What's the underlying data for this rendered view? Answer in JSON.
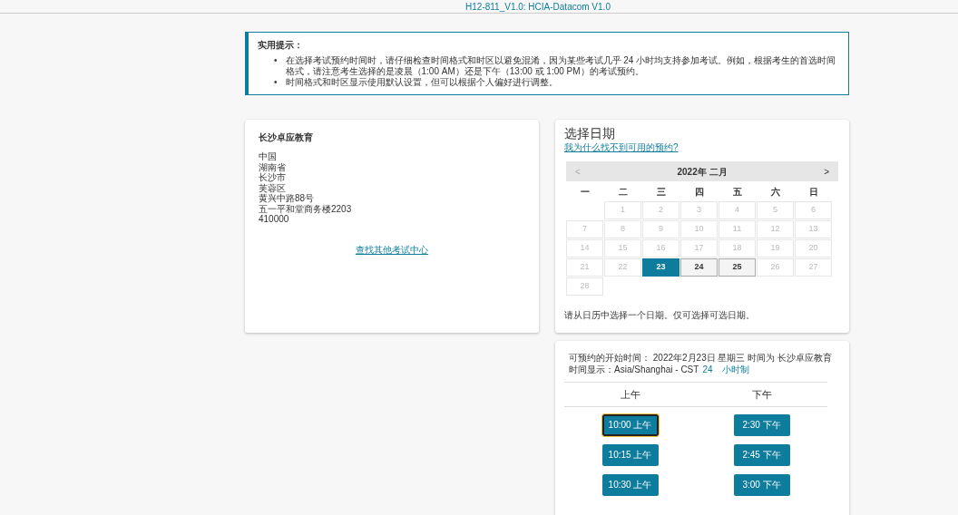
{
  "header": {
    "title": "H12-811_V1.0: HCIA-Datacom V1.0"
  },
  "notice": {
    "heading": "实用提示：",
    "marker": "•",
    "items": [
      "在选择考试预约时间时，请仔细检查时间格式和时区以避免混淆，因为某些考试几乎 24 小时均支持参加考试。例如，根据考生的首选时间格式，请注意考生选择的是凌晨（1:00 AM）还是下午（13:00 或 1:00 PM）的考试预约。",
      "时间格式和时区显示使用默认设置，但可以根据个人偏好进行调整。"
    ]
  },
  "test_center": {
    "name": "长沙卓应教育",
    "address_lines": [
      "中国",
      "湖南省",
      "长沙市",
      "芙蓉区",
      "黄兴中路88号",
      "五一平和堂商务楼2203",
      "410000"
    ],
    "link": "查找其他考试中心"
  },
  "date_picker": {
    "title": "选择日期",
    "help_link": "我为什么找不到可用的预约?",
    "prev": "<",
    "month": "2022年 二月",
    "next": ">",
    "weekdays": [
      "一",
      "二",
      "三",
      "四",
      "五",
      "六",
      "日"
    ],
    "days": [
      {
        "label": "1",
        "available": false,
        "selected": false
      },
      {
        "label": "2",
        "available": false,
        "selected": false
      },
      {
        "label": "3",
        "available": false,
        "selected": false
      },
      {
        "label": "4",
        "available": false,
        "selected": false
      },
      {
        "label": "5",
        "available": false,
        "selected": false
      },
      {
        "label": "6",
        "available": false,
        "selected": false
      },
      {
        "label": "7",
        "available": false,
        "selected": false
      },
      {
        "label": "8",
        "available": false,
        "selected": false
      },
      {
        "label": "9",
        "available": false,
        "selected": false
      },
      {
        "label": "10",
        "available": false,
        "selected": false
      },
      {
        "label": "11",
        "available": false,
        "selected": false
      },
      {
        "label": "12",
        "available": false,
        "selected": false
      },
      {
        "label": "13",
        "available": false,
        "selected": false
      },
      {
        "label": "14",
        "available": false,
        "selected": false
      },
      {
        "label": "15",
        "available": false,
        "selected": false
      },
      {
        "label": "16",
        "available": false,
        "selected": false
      },
      {
        "label": "17",
        "available": false,
        "selected": false
      },
      {
        "label": "18",
        "available": false,
        "selected": false
      },
      {
        "label": "19",
        "available": false,
        "selected": false
      },
      {
        "label": "20",
        "available": false,
        "selected": false
      },
      {
        "label": "21",
        "available": false,
        "selected": false
      },
      {
        "label": "22",
        "available": false,
        "selected": false
      },
      {
        "label": "23",
        "available": true,
        "selected": true
      },
      {
        "label": "24",
        "available": true,
        "selected": false
      },
      {
        "label": "25",
        "available": true,
        "selected": false
      },
      {
        "label": "26",
        "available": false,
        "selected": false
      },
      {
        "label": "27",
        "available": false,
        "selected": false
      },
      {
        "label": "28",
        "available": false,
        "selected": false
      }
    ],
    "hint": "请从日历中选择一个日期。仅可选择可选日期。"
  },
  "times": {
    "summary": "可预约的开始时间： 2022年2月23日 星期三 时间为 长沙卓应教育",
    "timezone": "时间显示：Asia/Shanghai - CST",
    "format_24": "24",
    "format_label": "小时制",
    "columns": [
      "上午",
      "下午"
    ],
    "slots": [
      {
        "morning": {
          "label": "10:00 上午",
          "selected": true
        },
        "afternoon": {
          "label": "2:30 下午",
          "selected": false
        }
      },
      {
        "morning": {
          "label": "10:15 上午",
          "selected": false
        },
        "afternoon": {
          "label": "2:45 下午",
          "selected": false
        }
      },
      {
        "morning": {
          "label": "10:30 上午",
          "selected": false
        },
        "afternoon": {
          "label": "3:00 下午",
          "selected": false
        }
      }
    ]
  }
}
